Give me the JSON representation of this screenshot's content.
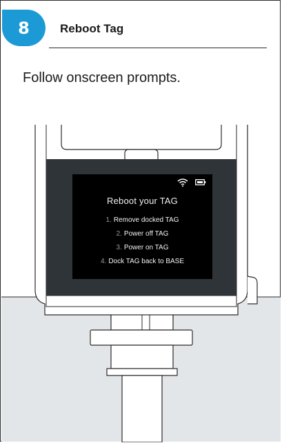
{
  "header": {
    "step_number": "8",
    "title": "Reboot Tag"
  },
  "instruction": "Follow onscreen prompts.",
  "device_screen": {
    "status_icons": [
      "wifi-icon",
      "battery-icon"
    ],
    "title": "Reboot your TAG",
    "steps": [
      {
        "num": "1.",
        "text": "Remove docked TAG"
      },
      {
        "num": "2.",
        "text": "Power off TAG"
      },
      {
        "num": "3.",
        "text": "Power on TAG"
      },
      {
        "num": "4.",
        "text": "Dock TAG back to BASE"
      }
    ]
  },
  "colors": {
    "accent": "#1c9ad6",
    "device_panel": "#2f3438",
    "base_fill": "#e2e6e8",
    "outline": "#2a2a2a"
  }
}
